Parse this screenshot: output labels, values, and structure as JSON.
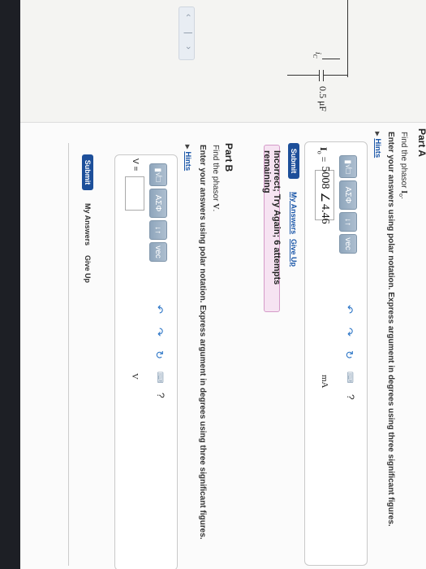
{
  "partA": {
    "title": "Part A",
    "prompt_prefix": "Find the phasor ",
    "prompt_var": "I",
    "prompt_sub": "o",
    "prompt_suffix": ".",
    "instruction": "Enter your answers using polar notation. Express argument in degrees using three significant figures.",
    "hints": "Hints",
    "toolbar": {
      "alpha": "ΑΣΦ",
      "arrows": "↓↑",
      "vec": "vec",
      "help": "?"
    },
    "answer_label": "I",
    "answer_sub": "o",
    "answer_eq": " =",
    "answer_mag": "5008",
    "answer_angle": "4.46",
    "unit": "mA",
    "submit": "Submit",
    "my_answers": "My Answers",
    "give_up": "Give Up",
    "feedback": "Incorrect; Try Again; 6 attempts remaining"
  },
  "partB": {
    "title": "Part B",
    "prompt_prefix": "Find the phasor ",
    "prompt_var": "V",
    "prompt_suffix": ".",
    "instruction": "Enter your answers using polar notation. Express argument in degrees using three significant figures.",
    "hints": "Hints",
    "toolbar": {
      "alpha": "ΑΣΦ",
      "arrows": "↓↑",
      "vec": "vec",
      "help": "?"
    },
    "answer_label": "V =",
    "unit": "V",
    "submit": "Submit",
    "my_answers": "My Answers",
    "give_up": "Give Up"
  },
  "circuit": {
    "cap_value": "0.5 μF",
    "current_label": "i",
    "current_sub": "C"
  },
  "colors": {
    "link": "#1a56a8",
    "submit": "#1d4f9a",
    "feedback_bg": "#f6e3f2",
    "feedback_border": "#d59bc9",
    "toolbar": "#9fb3c7",
    "icon_blue": "#2a74c6"
  }
}
